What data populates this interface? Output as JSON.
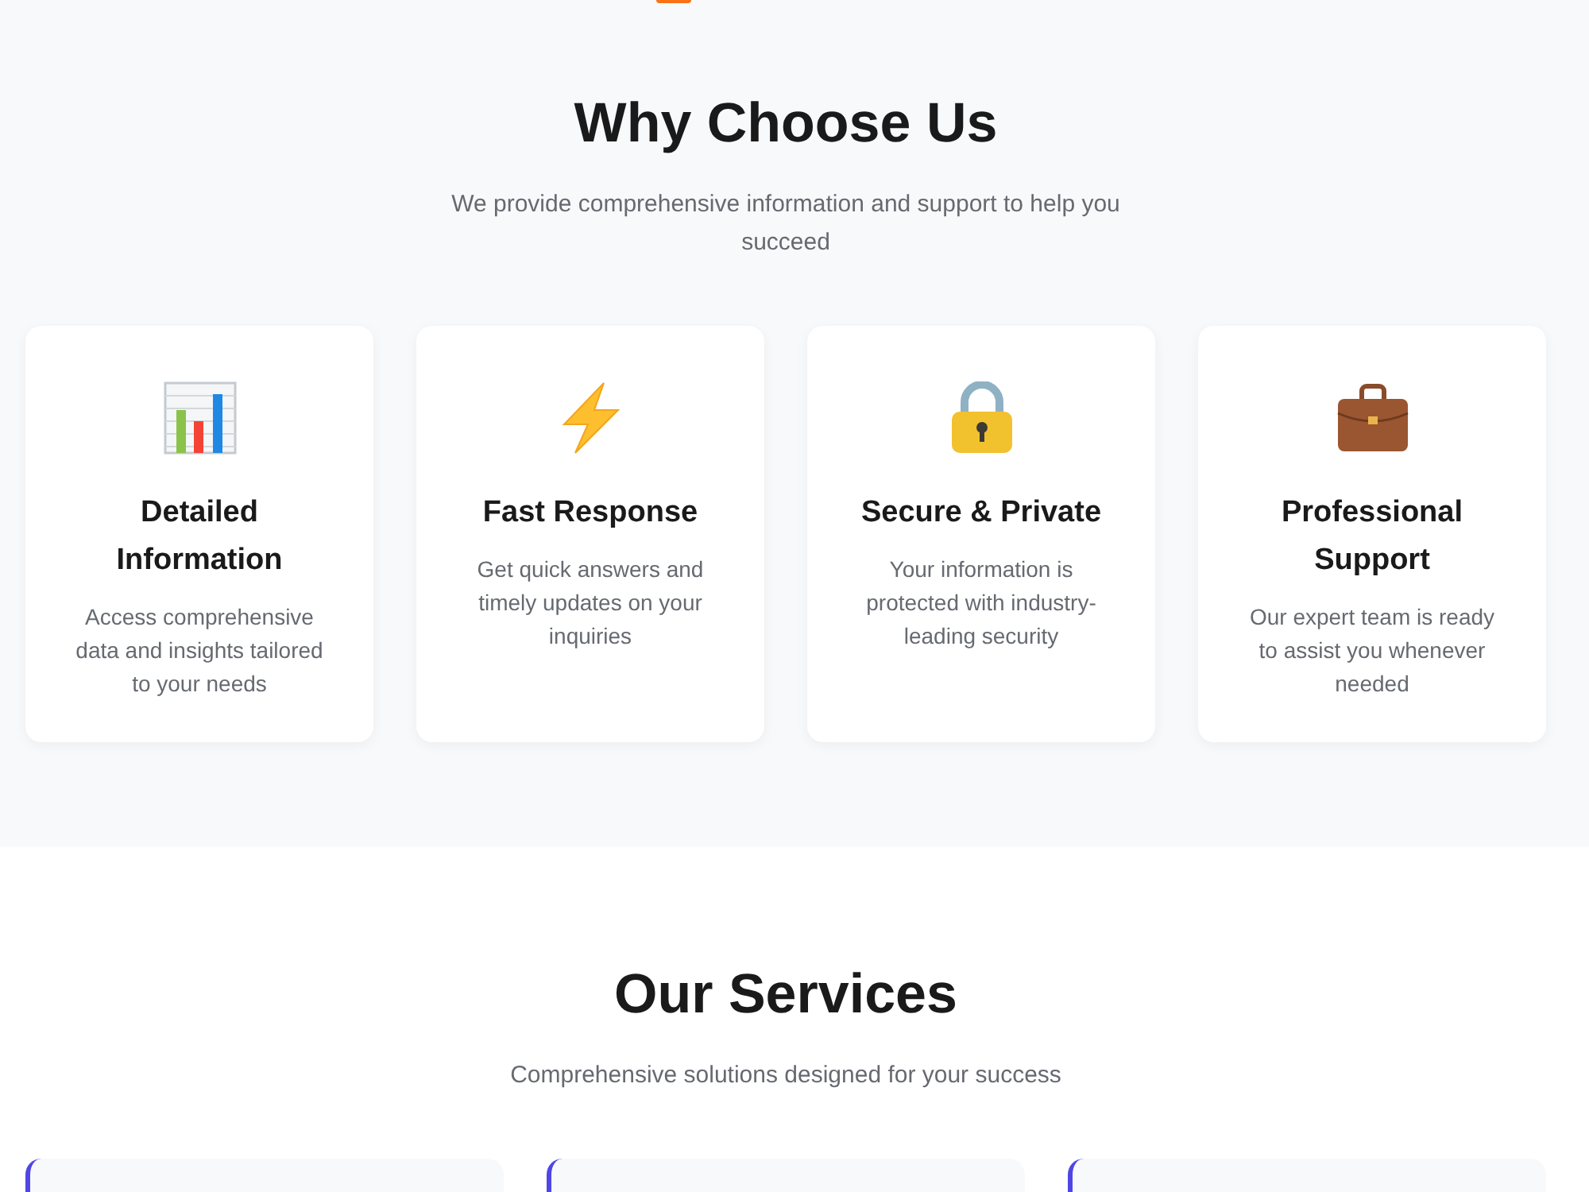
{
  "why_choose_us": {
    "title": "Why Choose Us",
    "subtitle": "We provide comprehensive information and support to help you succeed",
    "features": [
      {
        "title": "Detailed Information",
        "description": "Access comprehensive data and insights tailored to your needs"
      },
      {
        "title": "Fast Response",
        "description": "Get quick answers and timely updates on your inquiries"
      },
      {
        "title": "Secure & Private",
        "description": "Your information is protected with industry-leading security"
      },
      {
        "title": "Professional Support",
        "description": "Our expert team is ready to assist you whenever needed"
      }
    ]
  },
  "our_services": {
    "title": "Our Services",
    "subtitle": "Comprehensive solutions designed for your success",
    "cards": [
      {
        "kind": "service"
      },
      {
        "kind": "service"
      },
      {
        "kind": "service"
      }
    ]
  }
}
